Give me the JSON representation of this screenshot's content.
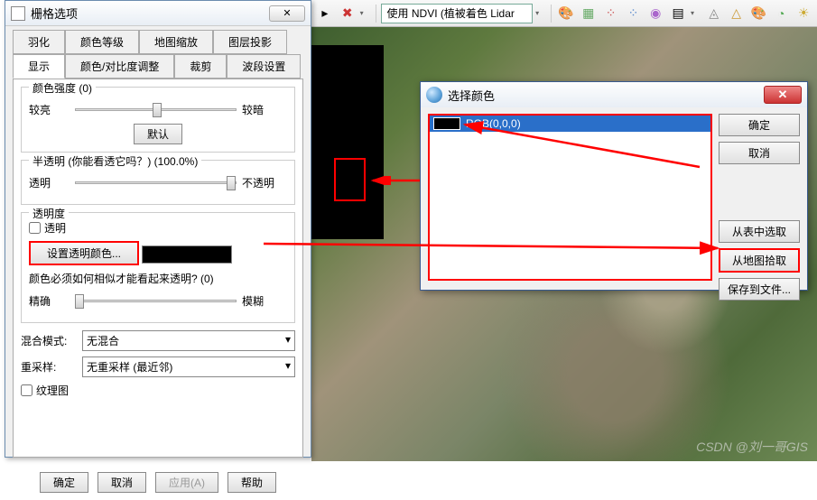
{
  "toolbar": {
    "ndvi_label": "使用 NDVI (植被着色 Lidar"
  },
  "raster_dialog": {
    "title": "栅格选项",
    "close": "✕",
    "tabs_row1": [
      "羽化",
      "颜色等级",
      "地图缩放",
      "图层投影"
    ],
    "tabs_row2": [
      "显示",
      "颜色/对比度调整",
      "裁剪",
      "波段设置"
    ],
    "active_tab": "显示",
    "intensity": {
      "label": "颜色强度 (0)",
      "brighter": "较亮",
      "darker": "较暗",
      "default_btn": "默认"
    },
    "translucent": {
      "label": "半透明 (你能看透它吗？) (100.0%)",
      "transparent": "透明",
      "opaque": "不透明"
    },
    "transparency": {
      "label": "透明度",
      "checkbox": "透明",
      "set_color_btn": "设置透明颜色...",
      "similarity_label": "颜色必须如何相似才能看起来透明? (0)",
      "exact": "精确",
      "fuzzy": "模糊"
    },
    "blend_mode": {
      "label": "混合模式:",
      "value": "无混合"
    },
    "resample": {
      "label": "重采样:",
      "value": "无重采样 (最近邻)"
    },
    "texture_map": "纹理图",
    "buttons": {
      "ok": "确定",
      "cancel": "取消",
      "apply": "应用(A)",
      "help": "帮助"
    }
  },
  "color_dialog": {
    "title": "选择颜色",
    "close": "✕",
    "list_item": "RGB(0,0,0)",
    "buttons": {
      "ok": "确定",
      "cancel": "取消",
      "from_table": "从表中选取",
      "from_map": "从地图拾取",
      "save_file": "保存到文件..."
    }
  },
  "watermark": "CSDN @刘一哥GIS"
}
